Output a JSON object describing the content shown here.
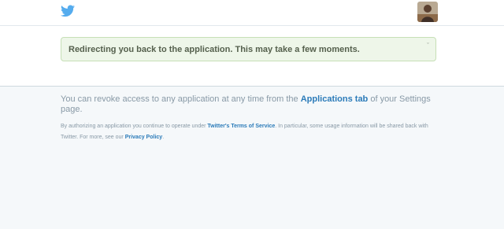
{
  "header": {
    "logo": "twitter-bird-icon",
    "avatar": "user-avatar"
  },
  "notice": {
    "text": "Redirecting you back to the application. This may take a few moments.",
    "close_glyph": "ˇ",
    "accent_color": "#eef6e9"
  },
  "footer": {
    "revoke_before": "You can revoke access to any application at any time from the ",
    "revoke_link": "Applications tab",
    "revoke_after": " of your Settings page.",
    "tos_before": "By authorizing an application you continue to operate under ",
    "tos_link": "Twitter's Terms of Service",
    "tos_middle": ". In particular, some usage information will be shared back with Twitter. For more, see our ",
    "privacy_link": "Privacy Policy",
    "tos_after": ".",
    "link_color": "#2b7bb9"
  }
}
